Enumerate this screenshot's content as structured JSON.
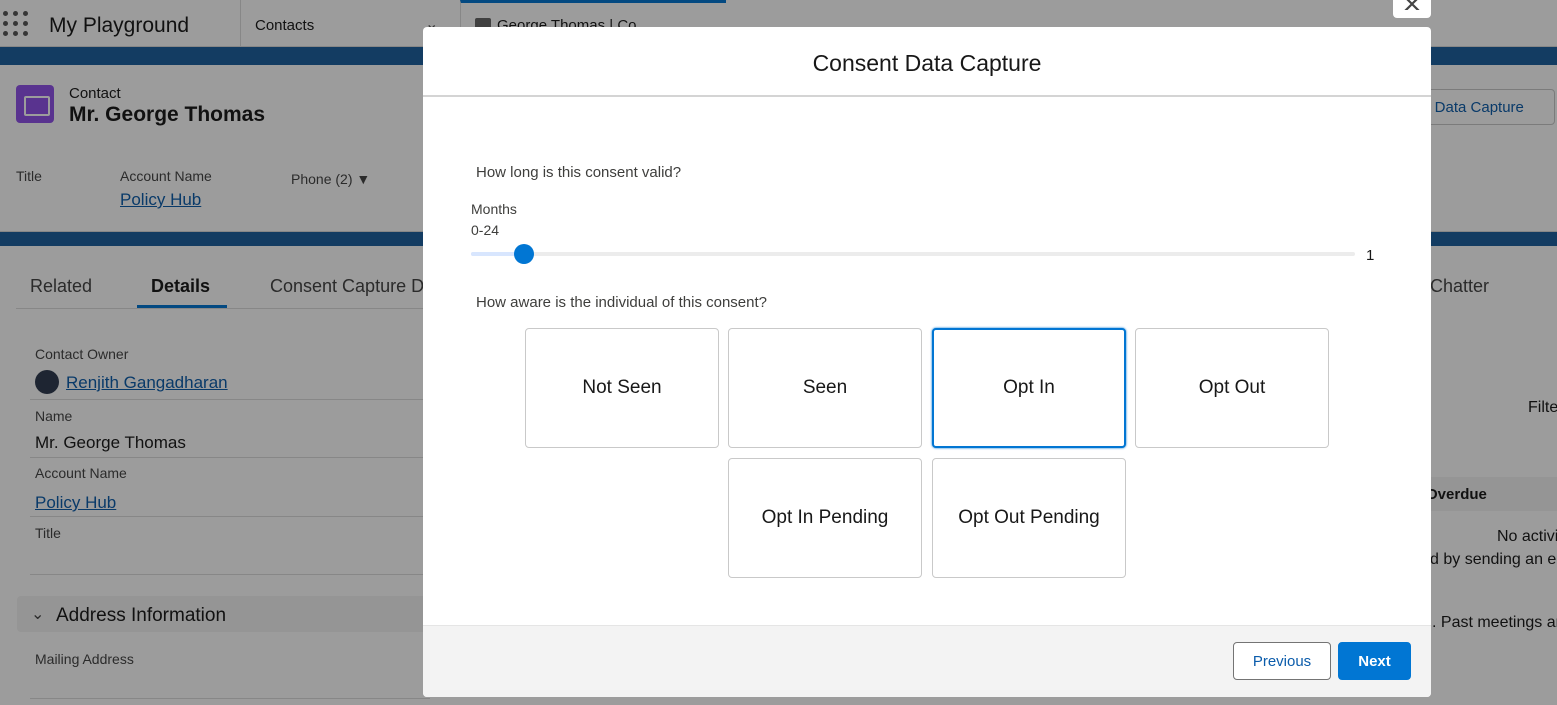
{
  "app": {
    "name": "My Playground",
    "nav_tabs": [
      {
        "label": "Contacts"
      },
      {
        "label": "George Thomas | Co..."
      }
    ]
  },
  "record": {
    "object_label": "Contact",
    "name": "Mr. George Thomas",
    "action_button": "nt Data Capture",
    "highlights": {
      "title_label": "Title",
      "account_label": "Account Name",
      "account_value": "Policy Hub",
      "phone_label": "Phone (2)"
    },
    "tabs": [
      {
        "label": "Related"
      },
      {
        "label": "Details"
      },
      {
        "label": "Consent Capture D"
      },
      {
        "label": "Chatter"
      }
    ],
    "fields": {
      "owner_label": "Contact Owner",
      "owner_value": "Renjith Gangadharan",
      "name_label": "Name",
      "name_value": "Mr. George Thomas",
      "account_label": "Account Name",
      "account_value": "Policy Hub",
      "title_label": "Title"
    },
    "address_section": "Address Information",
    "mailing_label": "Mailing Address",
    "side_panel": {
      "filter": "Filte",
      "overdue": "Overdue",
      "no_activity": "No activi",
      "email_hint": "d by sending an em",
      "meetings_hint": ". Past meetings an"
    }
  },
  "modal": {
    "title": "Consent Data Capture",
    "question_valid": "How long is this consent valid?",
    "slider": {
      "label": "Months",
      "range_text": "0-24",
      "min": 0,
      "max": 24,
      "value": 1,
      "value_text": "1"
    },
    "question_aware": "How aware is the individual of this consent?",
    "options": [
      {
        "label": "Not Seen",
        "selected": false
      },
      {
        "label": "Seen",
        "selected": false
      },
      {
        "label": "Opt In",
        "selected": true
      },
      {
        "label": "Opt Out",
        "selected": false
      },
      {
        "label": "Opt In Pending",
        "selected": false
      },
      {
        "label": "Opt Out Pending",
        "selected": false
      }
    ],
    "footer": {
      "previous": "Previous",
      "next": "Next"
    }
  },
  "colors": {
    "brand": "#0176d3",
    "link": "#0b5cab",
    "contact_icon": "#9050e9"
  }
}
